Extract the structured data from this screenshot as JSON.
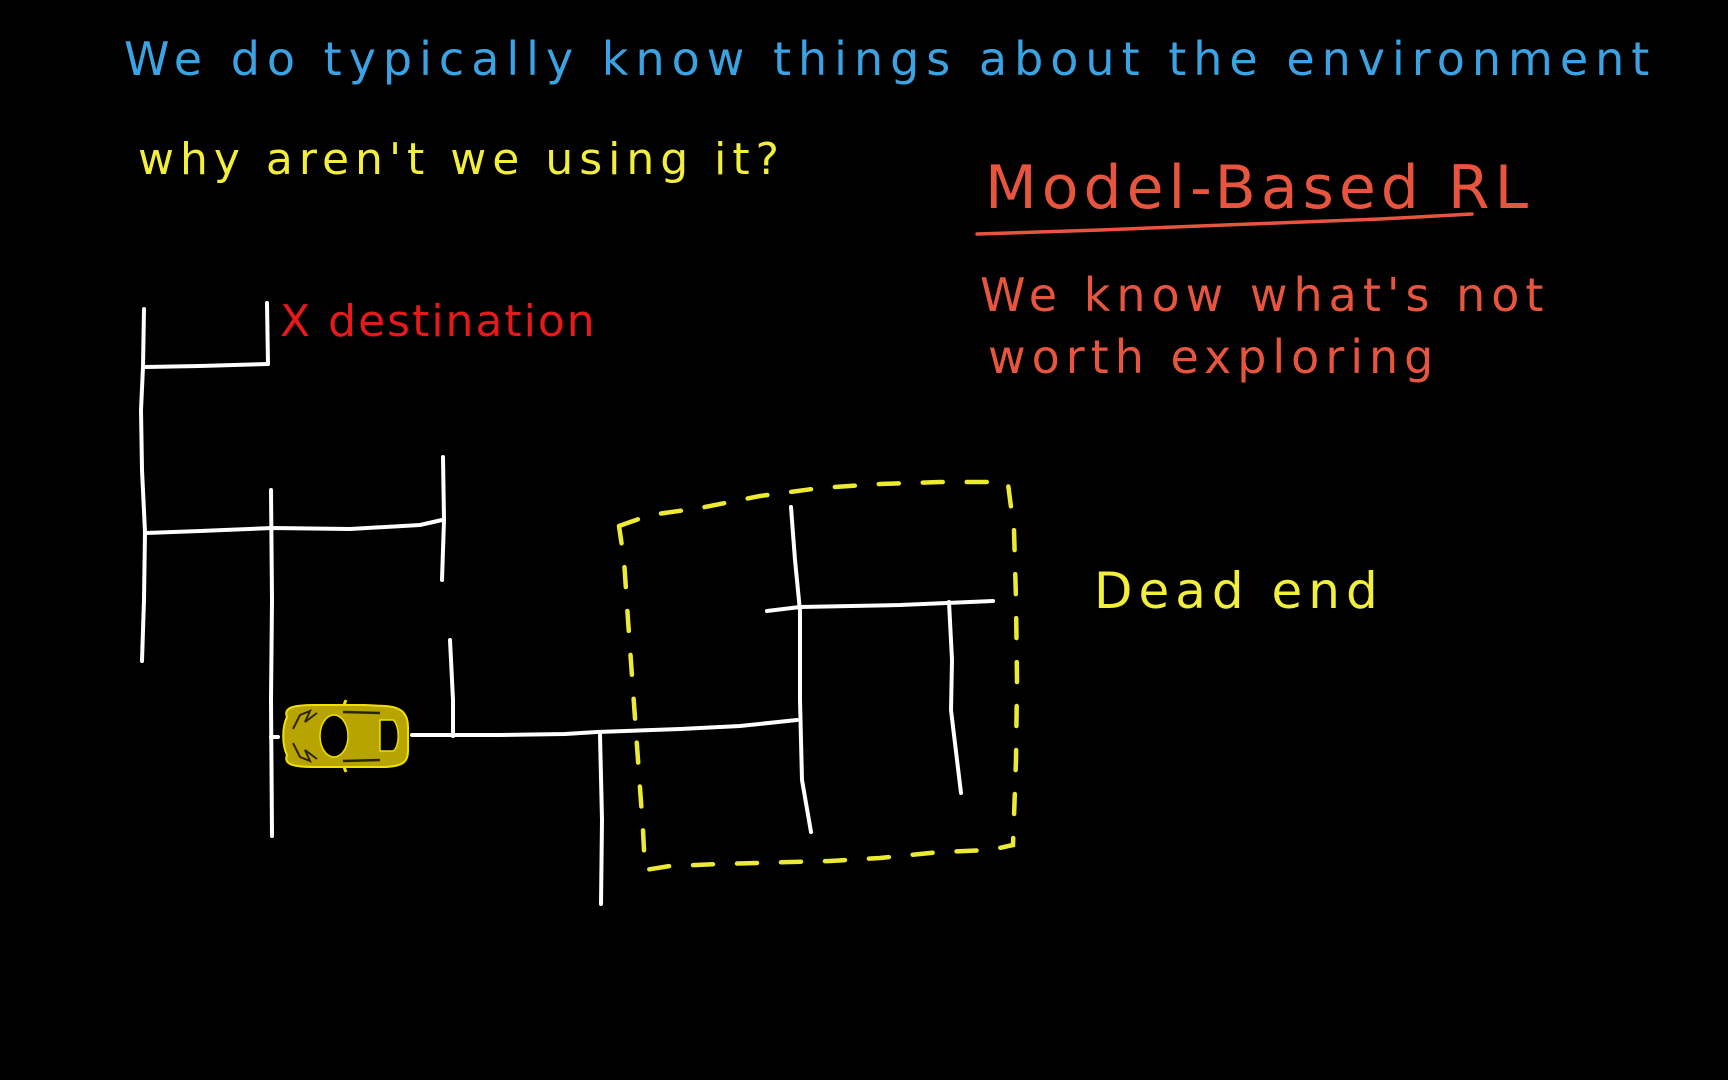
{
  "slide": {
    "background": "#000000",
    "heading": {
      "text": "We do typically know things about the environment",
      "color": "#3ba3e3"
    },
    "question": {
      "text": "why aren't we using it?",
      "color": "#f2ee3c"
    },
    "model_based": {
      "title": "Model-Based RL",
      "color": "#e8553f",
      "line1": "We know what's not",
      "line2": "worth exploring"
    },
    "destination": {
      "marker": "X",
      "text": "destination",
      "label": "X destination",
      "color": "#e8191b"
    },
    "dead_end": {
      "text": "Dead end",
      "color": "#f2ee3c"
    },
    "maze": {
      "wall_color": "#ffffff",
      "region_border_color": "#ecea32",
      "region_label": "Dead end"
    },
    "agent": {
      "icon": "car-icon",
      "body_color": "#b8a400",
      "outline_color": "#f0e000"
    }
  }
}
